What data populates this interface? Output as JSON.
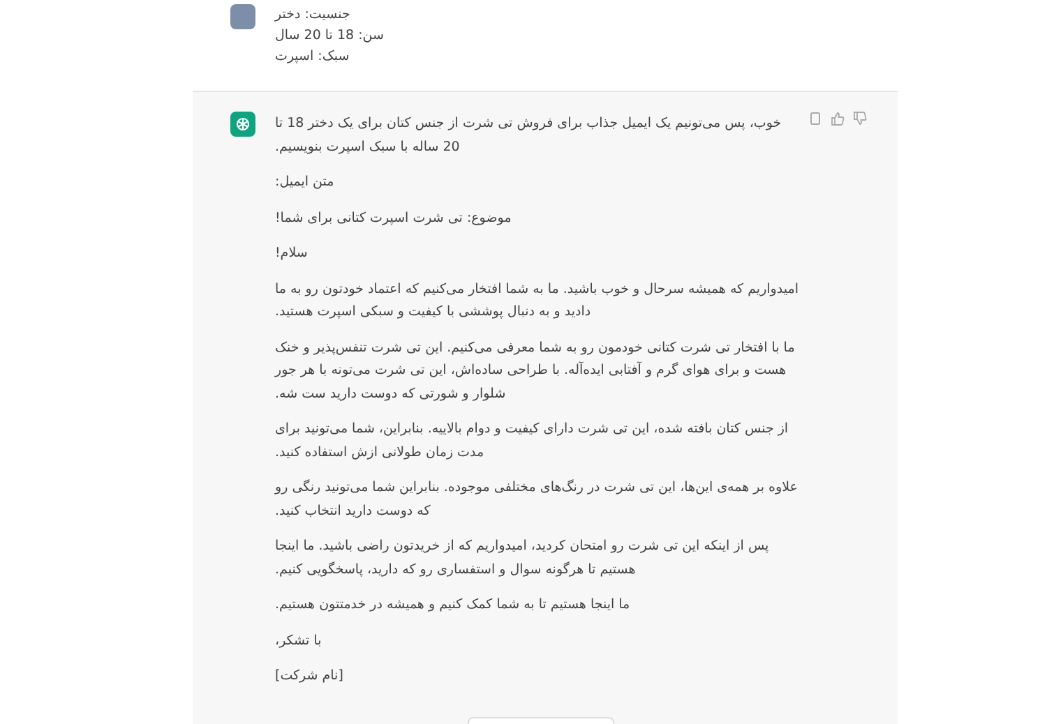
{
  "user_message": {
    "lines": [
      "جنسیت: دختر",
      "سن: 18 تا 20 سال",
      "سبک: اسپرت"
    ]
  },
  "assistant_message": {
    "paragraphs": [
      "خوب، پس می‌تونیم یک ایمیل جذاب برای فروش تی شرت از جنس کتان برای یک دختر 18 تا 20 ساله با سبک اسپرت بنویسیم.",
      "متن ایمیل:",
      "موضوع: تی شرت اسپرت کتانی برای شما!",
      "سلام!",
      "امیدواریم که همیشه سرحال و خوب باشید. ما به شما افتخار می‌کنیم که اعتماد خودتون رو به ما دادید و به دنبال پوششی با کیفیت و سبکی اسپرت هستید.",
      "ما با افتخار تی شرت کتانی خودمون رو به شما معرفی می‌کنیم. این تی شرت تنفس‌پذیر و خنک هست و برای هوای گرم و آفتابی ایده‌آله. با طراحی ساده‌اش، این تی شرت می‌تونه با هر جور شلوار و شورتی که دوست دارید ست شه.",
      "از جنس کتان بافته شده، این تی شرت دارای کیفیت و دوام بالاییه. بنابراین، شما می‌تونید برای مدت زمان طولانی ازش استفاده کنید.",
      "علاوه بر همه‌ی این‌ها، این تی شرت در رنگ‌های مختلفی موجوده. بنابراین شما می‌تونید رنگی رو که دوست دارید انتخاب کنید.",
      "پس از اینکه این تی شرت رو امتحان کردید، امیدواریم که از خریدتون راضی باشید. ما اینجا هستیم تا هرگونه سوال و استفساری رو که دارید، پاسخگویی کنیم.",
      "ما اینجا هستیم تا به شما کمک کنیم و همیشه در خدمتتون هستیم.",
      "با تشکر،",
      "[نام شرکت]"
    ]
  }
}
